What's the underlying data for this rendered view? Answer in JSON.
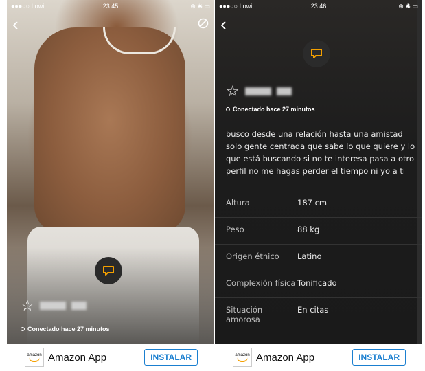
{
  "left": {
    "status": {
      "carrier": "●●●○○ Lowi",
      "time": "23:45",
      "icons": "⊕ ✱ ▭"
    },
    "online": "Conectado hace 27 minutos"
  },
  "right": {
    "status": {
      "carrier": "●●●○○ Lowi",
      "time": "23:46",
      "icons": "⊕ ✱ ▭"
    },
    "online": "Conectado hace 27 minutos",
    "description": "busco desde una relación hasta una amistad solo gente centrada que sabe lo que quiere y lo que está buscando si no te interesa pasa a otro perfil no me hagas perder el tiempo ni yo a ti",
    "attributes": [
      {
        "label": "Altura",
        "value": "187 cm"
      },
      {
        "label": "Peso",
        "value": "88 kg"
      },
      {
        "label": "Origen étnico",
        "value": "Latino"
      },
      {
        "label": "Complexión física",
        "value": "Tonificado"
      },
      {
        "label": "Situación amorosa",
        "value": "En citas"
      }
    ]
  },
  "ad": {
    "brand": "amazon",
    "name": "Amazon App",
    "button": "INSTALAR"
  },
  "colors": {
    "accent": "#f4a000",
    "link": "#1a7fd0"
  },
  "icons": [
    "back-chevron-icon",
    "block-icon",
    "chat-icon",
    "star-icon"
  ]
}
